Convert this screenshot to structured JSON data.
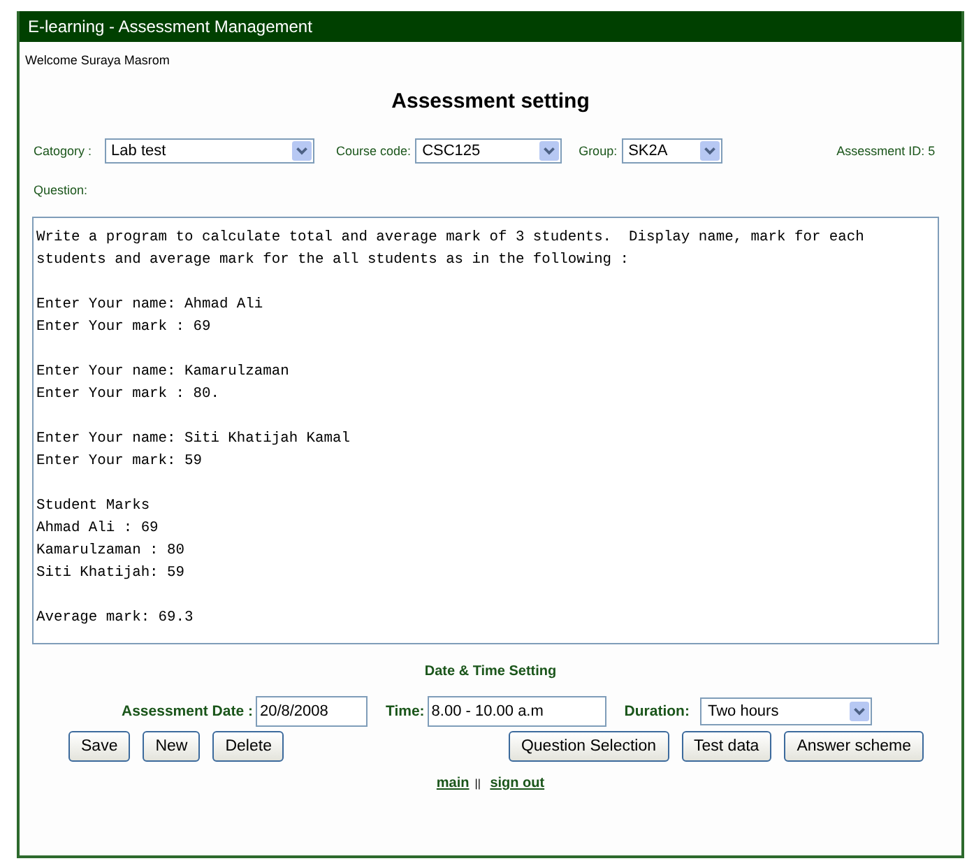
{
  "window": {
    "title": "E-learning - Assessment Management"
  },
  "welcome": "Welcome Suraya Masrom",
  "heading": "Assessment setting",
  "filters": [
    {
      "label": "Catogory :",
      "value": "Lab test"
    },
    {
      "label": "Course code:",
      "value": "CSC125"
    },
    {
      "label": "Group:",
      "value": "SK2A"
    }
  ],
  "assessment_id": "Assessment ID: 5",
  "question_label": "Question:",
  "question": "Write a program to calculate total and average mark of 3 students.  Display name, mark for each\nstudents and average mark for the all students as in the following :\n\nEnter Your name: Ahmad Ali\nEnter Your mark : 69\n\nEnter Your name: Kamarulzaman\nEnter Your mark : 80.\n\nEnter Your name: Siti Khatijah Kamal\nEnter Your mark: 59\n\nStudent Marks\nAhmad Ali : 69\nKamarulzaman : 80\nSiti Khatijah: 59\n\nAverage mark: 69.3",
  "date_time_heading": "Date & Time Setting",
  "date": {
    "label": "Assessment Date :",
    "value": "20/8/2008"
  },
  "time": {
    "label": "Time:",
    "value": "8.00 - 10.00 a.m"
  },
  "duration": {
    "label": "Duration:",
    "value": "Two hours"
  },
  "left_buttons": [
    "Save",
    "New",
    "Delete"
  ],
  "right_buttons": [
    "Question Selection",
    "Test data",
    "Answer scheme"
  ],
  "links": [
    {
      "label": "main"
    },
    {
      "label": "sign out"
    }
  ],
  "link_separator": "||"
}
